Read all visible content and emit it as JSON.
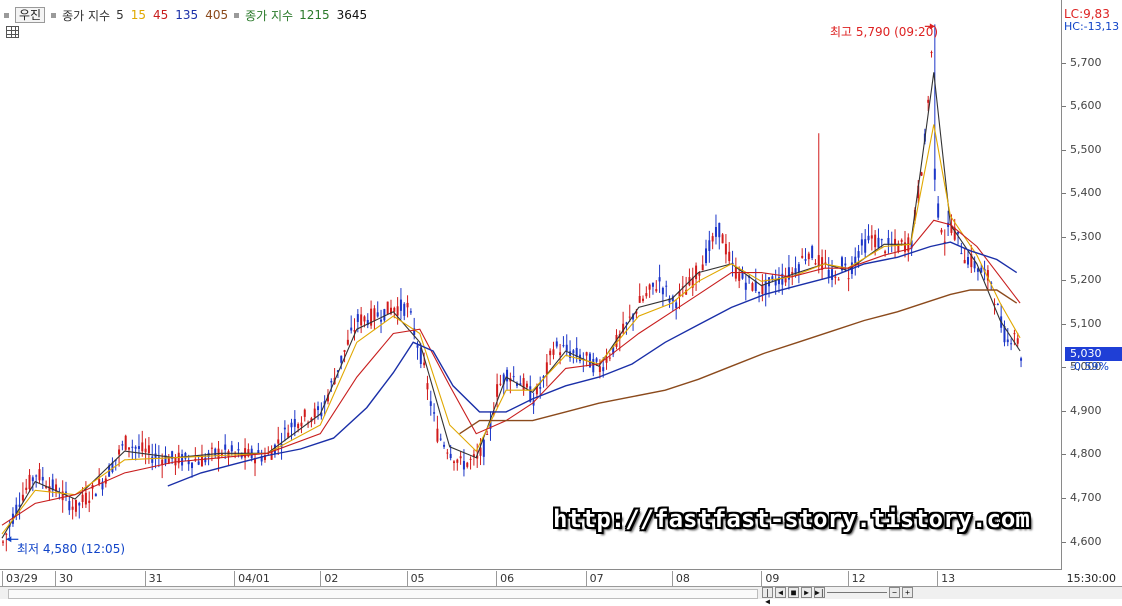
{
  "legend": {
    "security": "우진",
    "ma_label": "종가 지수",
    "ma_periods": [
      "5",
      "15",
      "45",
      "135",
      "405"
    ],
    "ma_colors": [
      "#333333",
      "#e0a800",
      "#c81e1e",
      "#1a2fa8",
      "#8b4a1c"
    ],
    "ma2_label": "종가 지수",
    "ma2_periods": [
      "1215",
      "3645"
    ],
    "ma2_colors": [
      "#2b7a2b",
      "#111111"
    ]
  },
  "axis_right": {
    "lc": "LC:9,83",
    "hc": "HC:-13,13",
    "current_price": "5,030",
    "current_change": "-0.59%",
    "corner_time": "15:30:00"
  },
  "annotations": {
    "high": "최고 5,790 (09:20)",
    "low": "최저 4,580 (12:05)"
  },
  "watermark": "http://fastfast-story.tistory.com",
  "icons": [
    "grid-icon",
    "scroll-first-icon",
    "scroll-prev-icon",
    "stop-icon",
    "scroll-next-icon",
    "scroll-last-icon",
    "zoom-out-icon",
    "zoom-in-icon"
  ],
  "chart_data": {
    "type": "candlestick",
    "title": "",
    "xlabel": "",
    "ylabel": "",
    "ylim": [
      4560,
      5800
    ],
    "y_ticks": [
      "4,600",
      "4,700",
      "4,800",
      "4,900",
      "5,000",
      "5,100",
      "5,200",
      "5,300",
      "5,400",
      "5,500",
      "5,600",
      "5,700"
    ],
    "y_tick_values": [
      4600,
      4700,
      4800,
      4900,
      5000,
      5100,
      5200,
      5300,
      5400,
      5500,
      5600,
      5700
    ],
    "x_ticks": [
      "03/29",
      "30",
      "31",
      "04/01",
      "02",
      "05",
      "06",
      "07",
      "08",
      "09",
      "12",
      "13"
    ],
    "x_tick_index": [
      0,
      16,
      43,
      70,
      96,
      122,
      149,
      176,
      202,
      229,
      255,
      282
    ],
    "x_count": 310,
    "price_path": {
      "x": [
        0,
        5,
        10,
        16,
        22,
        30,
        37,
        45,
        52,
        60,
        66,
        72,
        80,
        88,
        96,
        100,
        103,
        107,
        112,
        118,
        122,
        126,
        131,
        138,
        143,
        146,
        149,
        152,
        156,
        160,
        163,
        166,
        170,
        176,
        180,
        186,
        192,
        198,
        202,
        206,
        210,
        216,
        220,
        224,
        229,
        233,
        238,
        243,
        248,
        251,
        253,
        255,
        258,
        262,
        266,
        270,
        274,
        278,
        280,
        281,
        282,
        284,
        286,
        290,
        294,
        298,
        301,
        303,
        305,
        307
      ],
      "y": [
        4600,
        4700,
        4760,
        4720,
        4680,
        4740,
        4830,
        4800,
        4790,
        4790,
        4810,
        4800,
        4800,
        4880,
        4900,
        4980,
        5040,
        5110,
        5120,
        5140,
        5140,
        5030,
        4850,
        4780,
        4790,
        4830,
        4950,
        4990,
        4970,
        4930,
        4970,
        5050,
        5040,
        5020,
        5000,
        5070,
        5150,
        5200,
        5150,
        5180,
        5230,
        5320,
        5230,
        5200,
        5180,
        5200,
        5220,
        5270,
        5230,
        5200,
        5240,
        5220,
        5270,
        5300,
        5280,
        5280,
        5290,
        5520,
        5720,
        5450,
        5360,
        5300,
        5330,
        5260,
        5230,
        5200,
        5100,
        5060,
        5090,
        5030
      ]
    },
    "series": [
      {
        "name": "5",
        "x": [
          0,
          10,
          22,
          37,
          52,
          66,
          80,
          96,
          107,
          118,
          126,
          135,
          143,
          152,
          160,
          170,
          180,
          192,
          202,
          210,
          220,
          229,
          238,
          248,
          255,
          266,
          274,
          281,
          286,
          294,
          301,
          307
        ],
        "values": [
          4610,
          4740,
          4700,
          4810,
          4795,
          4805,
          4805,
          4895,
          5090,
          5130,
          5060,
          4820,
          4795,
          4980,
          4945,
          5040,
          5005,
          5140,
          5160,
          5220,
          5240,
          5190,
          5215,
          5240,
          5225,
          5285,
          5285,
          5680,
          5330,
          5240,
          5110,
          5040
        ]
      },
      {
        "name": "15",
        "x": [
          0,
          10,
          22,
          37,
          52,
          66,
          80,
          96,
          107,
          118,
          126,
          135,
          143,
          152,
          160,
          170,
          180,
          192,
          202,
          210,
          220,
          229,
          238,
          248,
          255,
          266,
          274,
          281,
          286,
          294,
          301,
          307
        ],
        "values": [
          4620,
          4720,
          4710,
          4790,
          4795,
          4800,
          4805,
          4870,
          5060,
          5120,
          5080,
          4870,
          4810,
          4950,
          4950,
          5030,
          5010,
          5120,
          5150,
          5200,
          5240,
          5200,
          5210,
          5240,
          5230,
          5280,
          5285,
          5560,
          5350,
          5260,
          5150,
          5070
        ]
      },
      {
        "name": "45",
        "x": [
          0,
          10,
          22,
          37,
          52,
          66,
          80,
          96,
          107,
          118,
          126,
          135,
          143,
          152,
          160,
          170,
          180,
          192,
          202,
          210,
          220,
          229,
          238,
          248,
          255,
          266,
          274,
          281,
          286,
          294,
          301,
          307
        ],
        "values": [
          4640,
          4690,
          4710,
          4760,
          4785,
          4795,
          4805,
          4850,
          4980,
          5080,
          5090,
          4960,
          4850,
          4880,
          4920,
          5000,
          5010,
          5080,
          5130,
          5170,
          5220,
          5220,
          5210,
          5230,
          5230,
          5260,
          5275,
          5340,
          5330,
          5280,
          5210,
          5150
        ]
      },
      {
        "name": "135",
        "x": [
          50,
          60,
          70,
          80,
          90,
          100,
          110,
          118,
          124,
          130,
          136,
          144,
          152,
          160,
          170,
          180,
          190,
          200,
          210,
          220,
          230,
          240,
          250,
          260,
          270,
          280,
          286,
          292,
          300,
          306
        ],
        "values": [
          4730,
          4760,
          4780,
          4800,
          4815,
          4840,
          4910,
          4990,
          5060,
          5040,
          4960,
          4900,
          4900,
          4930,
          4960,
          4980,
          5010,
          5060,
          5100,
          5140,
          5170,
          5190,
          5210,
          5240,
          5255,
          5280,
          5290,
          5270,
          5250,
          5220
        ]
      },
      {
        "name": "405",
        "x": [
          138,
          144,
          150,
          160,
          170,
          180,
          190,
          200,
          210,
          220,
          230,
          240,
          250,
          260,
          270,
          280,
          286,
          292,
          300,
          306
        ],
        "values": [
          4850,
          4880,
          4880,
          4880,
          4900,
          4920,
          4935,
          4950,
          4975,
          5005,
          5035,
          5060,
          5085,
          5110,
          5130,
          5155,
          5170,
          5180,
          5180,
          5150
        ]
      }
    ]
  }
}
